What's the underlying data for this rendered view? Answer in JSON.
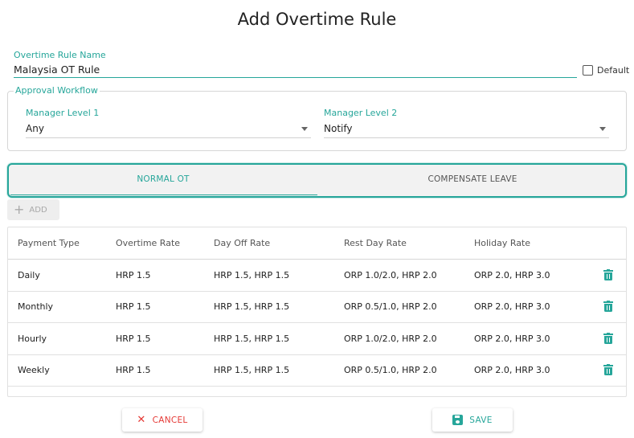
{
  "title": "Add Overtime Rule",
  "rule_name": {
    "label": "Overtime Rule Name",
    "value": "Malaysia OT Rule"
  },
  "default_checkbox": {
    "label": "Default",
    "checked": false
  },
  "approval": {
    "legend": "Approval Workflow",
    "manager1": {
      "label": "Manager Level 1",
      "value": "Any"
    },
    "manager2": {
      "label": "Manager Level 2",
      "value": "Notify"
    }
  },
  "tabs": [
    {
      "label": "NORMAL OT",
      "active": true
    },
    {
      "label": "COMPENSATE LEAVE",
      "active": false
    }
  ],
  "add_label": "ADD",
  "table": {
    "headers": [
      "Payment Type",
      "Overtime Rate",
      "Day Off Rate",
      "Rest Day Rate",
      "Holiday Rate"
    ],
    "rows": [
      [
        "Daily",
        "HRP 1.5",
        "HRP 1.5, HRP 1.5",
        "ORP 1.0/2.0, HRP 2.0",
        "ORP 2.0, HRP 3.0"
      ],
      [
        "Monthly",
        "HRP 1.5",
        "HRP 1.5, HRP 1.5",
        "ORP 0.5/1.0, HRP 2.0",
        "ORP 2.0, HRP 3.0"
      ],
      [
        "Hourly",
        "HRP 1.5",
        "HRP 1.5, HRP 1.5",
        "ORP 1.0/2.0, HRP 2.0",
        "ORP 2.0, HRP 3.0"
      ],
      [
        "Weekly",
        "HRP 1.5",
        "HRP 1.5, HRP 1.5",
        "ORP 0.5/1.0, HRP 2.0",
        "ORP 2.0, HRP 3.0"
      ]
    ]
  },
  "buttons": {
    "cancel": "CANCEL",
    "save": "SAVE"
  },
  "colors": {
    "accent": "#26a69a",
    "danger": "#e53935"
  }
}
